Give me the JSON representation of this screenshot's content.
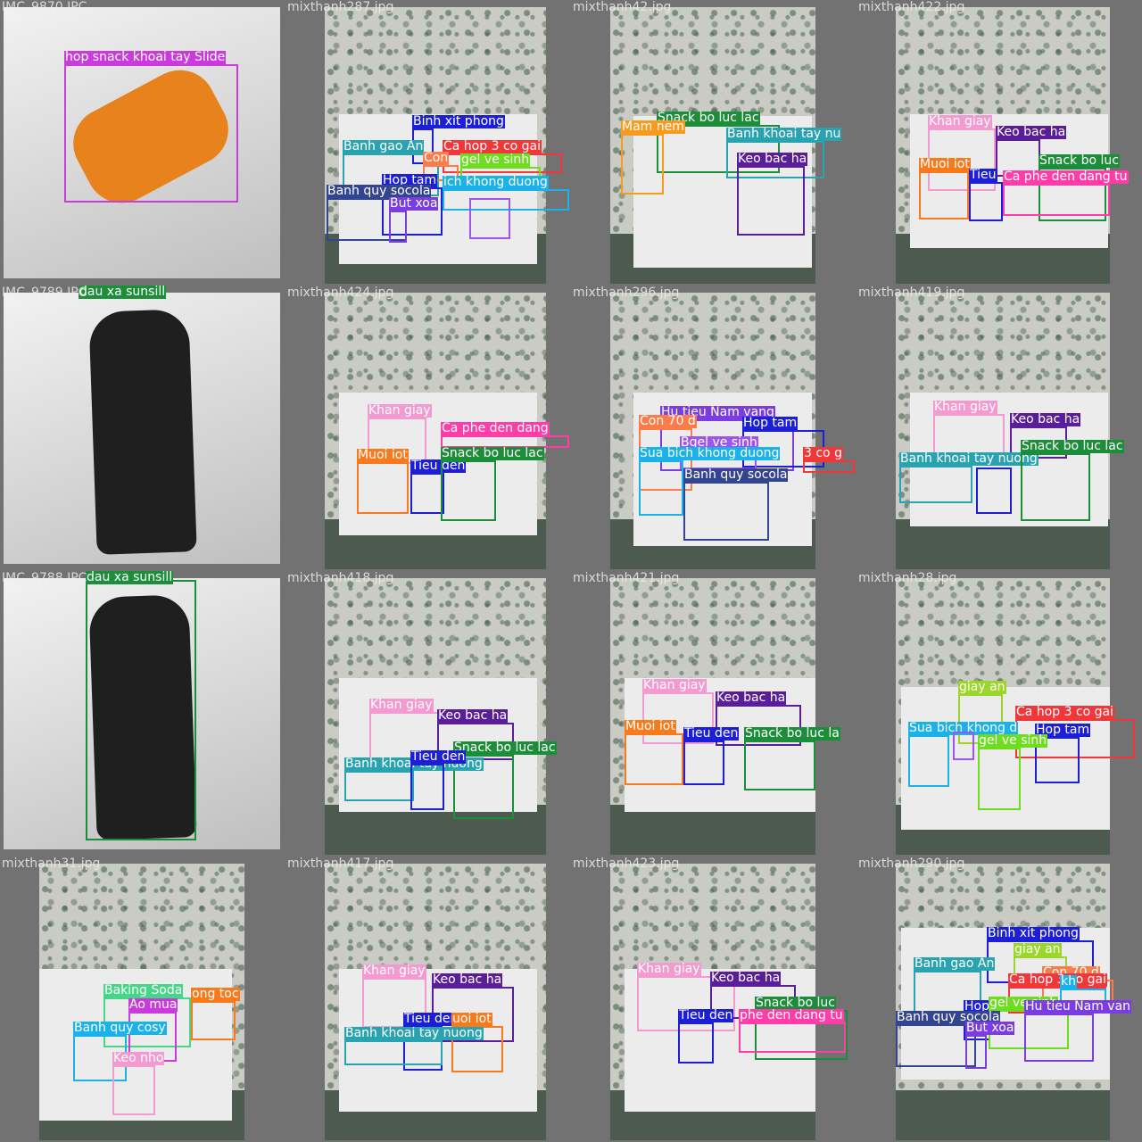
{
  "tiles": [
    {
      "name": "IMC_9870.JPC",
      "scene": "white",
      "objects": [
        {
          "color": "#e8821c",
          "shape": "can"
        }
      ],
      "boxes": [
        {
          "label": "hop snack khoai tay Slide",
          "color": "#c93bdb"
        }
      ]
    },
    {
      "name": "mixthanh287.jpg",
      "scene": "room",
      "boxes": [
        {
          "label": "Binh xit phong",
          "color": "#1c1fd6"
        },
        {
          "label": "Banh gao An",
          "color": "#2aa3b0"
        },
        {
          "label": "Ca hop 3 co gai",
          "color": "#f2373b"
        },
        {
          "label": "Con",
          "color": "#fb7b4a"
        },
        {
          "label": "gel ve sinh",
          "color": "#6edc1f"
        },
        {
          "label": "Hop tam",
          "color": "#1c1fd6"
        },
        {
          "label": "ich khong duong",
          "color": "#1ab2e8"
        },
        {
          "label": "Banh quy socola",
          "color": "#33458f"
        },
        {
          "label": "But xoa",
          "color": "#7b3de0"
        },
        {
          "label": "",
          "color": "#9d55ee"
        }
      ]
    },
    {
      "name": "mixthanh42.jpg",
      "scene": "room",
      "boxes": [
        {
          "label": "Snack bo luc lac",
          "color": "#1c8e3a"
        },
        {
          "label": "Mam nem",
          "color": "#f79b1f"
        },
        {
          "label": "Banh khoai tay nu",
          "color": "#2aa3b0"
        },
        {
          "label": "Keo bac ha",
          "color": "#5b1e99"
        }
      ]
    },
    {
      "name": "mixthanh422.jpg",
      "scene": "room",
      "boxes": [
        {
          "label": "Khan giay",
          "color": "#f39ad0"
        },
        {
          "label": "Keo bac ha",
          "color": "#5b1e99"
        },
        {
          "label": "Snack bo luc",
          "color": "#1c8e3a"
        },
        {
          "label": "Muoi iot",
          "color": "#f97a1c"
        },
        {
          "label": "Tieu",
          "color": "#1c1fd6"
        },
        {
          "label": "Ca phe den dang tu",
          "color": "#ff3da8"
        }
      ]
    },
    {
      "name": "IMC_9789.JPC",
      "scene": "white",
      "objects": [
        {
          "color": "#1f1f1f",
          "shape": "bottle"
        }
      ],
      "boxes": [
        {
          "label": "dau xa sunsill",
          "color": "#1c8e3a"
        }
      ]
    },
    {
      "name": "mixthanh424.jpg",
      "scene": "room",
      "boxes": [
        {
          "label": "Khan giay",
          "color": "#f39ad0"
        },
        {
          "label": "Ca phe den dang",
          "color": "#ff3da8"
        },
        {
          "label": "Muoi iot",
          "color": "#f97a1c"
        },
        {
          "label": "Tieu den",
          "color": "#1c1fd6"
        },
        {
          "label": "Snack bo luc lac",
          "color": "#1c8e3a"
        }
      ]
    },
    {
      "name": "mixthanh296.jpg",
      "scene": "room",
      "boxes": [
        {
          "label": "Hu tieu Nam vang",
          "color": "#7b3de0"
        },
        {
          "label": "Con 70 d",
          "color": "#fb7b4a"
        },
        {
          "label": "Hop tam",
          "color": "#1c1fd6"
        },
        {
          "label": "Bgel ve sinh",
          "color": "#9d55ee"
        },
        {
          "label": "Sua bich khong duong",
          "color": "#1ab2e8"
        },
        {
          "label": "3 co g",
          "color": "#f2373b"
        },
        {
          "label": "Banh quy socola",
          "color": "#33458f"
        }
      ]
    },
    {
      "name": "mixthanh419.jpg",
      "scene": "room",
      "boxes": [
        {
          "label": "Khan giay",
          "color": "#f39ad0"
        },
        {
          "label": "Keo bac ha",
          "color": "#5b1e99"
        },
        {
          "label": "Banh khoai tay nuong",
          "color": "#2aa3b0"
        },
        {
          "label": "Snack bo luc lac",
          "color": "#1c8e3a"
        },
        {
          "label": "",
          "color": "#1c1fd6"
        }
      ]
    },
    {
      "name": "IMC_9788.JPC",
      "scene": "white",
      "objects": [
        {
          "color": "#1f1f1f",
          "shape": "bottle"
        }
      ],
      "boxes": [
        {
          "label": "dau xa sunsill",
          "color": "#1c8e3a"
        }
      ]
    },
    {
      "name": "mixthanh418.jpg",
      "scene": "room",
      "boxes": [
        {
          "label": "Khan giay",
          "color": "#f39ad0"
        },
        {
          "label": "Keo bac ha",
          "color": "#5b1e99"
        },
        {
          "label": "Snack bo luc lac",
          "color": "#1c8e3a"
        },
        {
          "label": "Banh khoai tay nuong",
          "color": "#2aa3b0"
        },
        {
          "label": "Tieu den",
          "color": "#1c1fd6"
        }
      ]
    },
    {
      "name": "mixthanh421.jpg",
      "scene": "room",
      "boxes": [
        {
          "label": "Khan giay",
          "color": "#f39ad0"
        },
        {
          "label": "Keo bac ha",
          "color": "#5b1e99"
        },
        {
          "label": "Muoi iot",
          "color": "#f97a1c"
        },
        {
          "label": "Tieu den",
          "color": "#1c1fd6"
        },
        {
          "label": "Snack bo luc la",
          "color": "#1c8e3a"
        }
      ]
    },
    {
      "name": "mixthanh28.jpg",
      "scene": "room",
      "boxes": [
        {
          "label": "giay an",
          "color": "#9bd62a"
        },
        {
          "label": "Ca hop 3 co gai",
          "color": "#f2373b"
        },
        {
          "label": "Sua bich khong d",
          "color": "#1ab2e8"
        },
        {
          "label": "Hop tam",
          "color": "#1c1fd6"
        },
        {
          "label": "gel ve sinh",
          "color": "#6edc1f"
        },
        {
          "label": "",
          "color": "#9d55ee"
        }
      ]
    },
    {
      "name": "mixthanh31.jpg",
      "scene": "room",
      "boxes": [
        {
          "label": "Baking Soda",
          "color": "#45d687"
        },
        {
          "label": "ong toc",
          "color": "#f97a1c"
        },
        {
          "label": "Ao mua",
          "color": "#c93bdb"
        },
        {
          "label": "Banh quy cosy",
          "color": "#1ab2e8"
        },
        {
          "label": "Keo nho",
          "color": "#f39ad0"
        }
      ]
    },
    {
      "name": "mixthanh417.jpg",
      "scene": "room",
      "boxes": [
        {
          "label": "Khan giay",
          "color": "#f39ad0"
        },
        {
          "label": "Keo bac ha",
          "color": "#5b1e99"
        },
        {
          "label": "Tieu den",
          "color": "#1c1fd6"
        },
        {
          "label": "uoi iot",
          "color": "#f97a1c"
        },
        {
          "label": "Banh khoai tay nuong",
          "color": "#2aa3b0"
        }
      ]
    },
    {
      "name": "mixthanh423.jpg",
      "scene": "room",
      "boxes": [
        {
          "label": "Khan giay",
          "color": "#f39ad0"
        },
        {
          "label": "Keo bac ha",
          "color": "#5b1e99"
        },
        {
          "label": "Snack bo luc",
          "color": "#1c8e3a"
        },
        {
          "label": "Tieu den",
          "color": "#1c1fd6"
        },
        {
          "label": "phe den dang tu",
          "color": "#ff3da8"
        }
      ]
    },
    {
      "name": "mixthanh290.jpg",
      "scene": "room",
      "boxes": [
        {
          "label": "Binh xit phong",
          "color": "#1c1fd6"
        },
        {
          "label": "giay an",
          "color": "#9bd62a"
        },
        {
          "label": "Banh gao An",
          "color": "#2aa3b0"
        },
        {
          "label": "Con 70 d",
          "color": "#fb7b4a"
        },
        {
          "label": "Ca hop 3 co gai",
          "color": "#f2373b"
        },
        {
          "label": "kh",
          "color": "#1ab2e8"
        },
        {
          "label": "Hop",
          "color": "#1c1fd6"
        },
        {
          "label": "gel ve sinh",
          "color": "#6edc1f"
        },
        {
          "label": "Hu tieu Nam van",
          "color": "#7b3de0"
        },
        {
          "label": "Banh quy socola",
          "color": "#33458f"
        },
        {
          "label": "But xoa",
          "color": "#7b3de0"
        }
      ]
    }
  ]
}
